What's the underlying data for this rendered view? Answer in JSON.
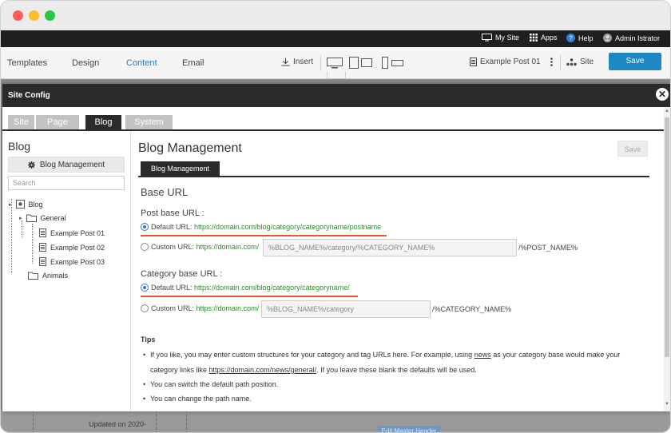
{
  "topbar": {
    "mysite": "My Site",
    "apps": "Apps",
    "help": "Help",
    "user": "Admin Istrator"
  },
  "editbar": {
    "tabs": [
      "Templates",
      "Design",
      "Content",
      "Email"
    ],
    "active_tab": "Content",
    "insert": "Insert",
    "page_selector": "Example Post 01",
    "site": "Site",
    "save": "Save"
  },
  "background": {
    "text1": "Updated on 2020-",
    "button": "Edit Master Header"
  },
  "modal": {
    "title": "Site Config",
    "tabs": [
      "Site",
      "Page",
      "Blog",
      "System"
    ],
    "active_tab": "Blog"
  },
  "sidebar": {
    "title": "Blog",
    "button": "Blog Management",
    "search_placeholder": "Search",
    "tree": {
      "root": "Blog",
      "general": "General",
      "posts": [
        "Example Post 01",
        "Example Post 02",
        "Example Post 03"
      ],
      "animals": "Animals"
    }
  },
  "main": {
    "title": "Blog Management",
    "save": "Save",
    "subtab": "Blog Management",
    "section": "Base URL",
    "post_label": "Post base URL :",
    "post_default_label": "Default URL:",
    "post_default_url": "https://domain.com/blog/category/categoryname/postname",
    "post_custom_label": "Custom URL:",
    "post_custom_prefix": "https://domain.com/",
    "post_custom_value": "%BLOG_NAME%/category/%CATEGORY_NAME%",
    "post_custom_suffix": "/%POST_NAME%",
    "cat_label": "Category base URL :",
    "cat_default_label": "Default URL:",
    "cat_default_url": "https://domain.com/blog/category/categoryname/",
    "cat_custom_label": "Custom URL:",
    "cat_custom_prefix": "https://domain.com/",
    "cat_custom_value": "%BLOG_NAME%/category",
    "cat_custom_suffix": "/%CATEGORY_NAME%",
    "tips_title": "Tips",
    "tip1_a": "If you like, you may enter custom structures for your category and tag URLs here. For example, using ",
    "tip1_link": "news",
    "tip1_b": " as your category base would make your",
    "tip1_c": "category links like ",
    "tip1_link2": "https://domain.com/news/general/",
    "tip1_d": ". If you leave these blank the defaults will be used.",
    "tip2": "You can switch the default path position.",
    "tip3": "You can change the path name."
  },
  "colors": {
    "accent": "#1e88c7",
    "url_green": "#2e8b2e",
    "highlight": "#e4572e",
    "dark": "#2b2b2b"
  }
}
